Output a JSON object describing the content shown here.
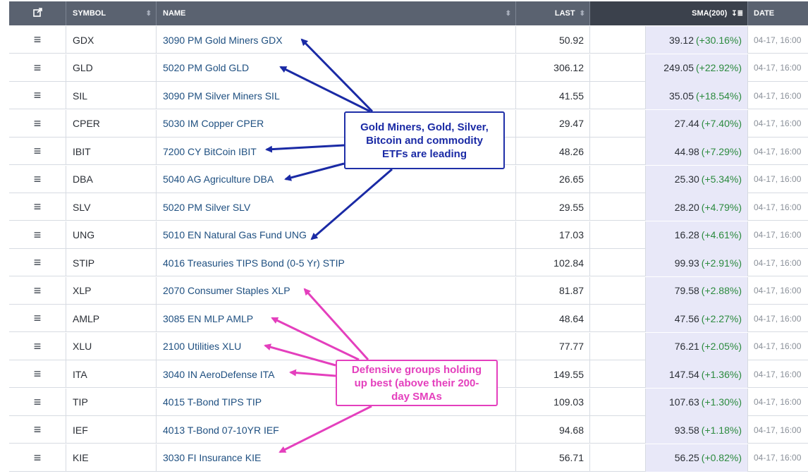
{
  "colors": {
    "header_bg": "#5a6270",
    "name_link": "#1e4f80",
    "sma_bg": "#e8e8f8",
    "positive": "#2b8a3e",
    "blue_annotation": "#1a2aa5",
    "pink_annotation": "#e43fbd"
  },
  "header": {
    "popout_icon": "popout-icon",
    "symbol": "SYMBOL",
    "name": "NAME",
    "last": "LAST",
    "sma": "SMA(200)",
    "date": "DATE"
  },
  "rows": [
    {
      "symbol": "GDX",
      "name": "3090 PM Gold Miners GDX",
      "last": "50.92",
      "sma": "39.12",
      "pct": "(+30.16%)",
      "date": "04-17, 16:00"
    },
    {
      "symbol": "GLD",
      "name": "5020 PM Gold GLD",
      "last": "306.12",
      "sma": "249.05",
      "pct": "(+22.92%)",
      "date": "04-17, 16:00"
    },
    {
      "symbol": "SIL",
      "name": "3090 PM Silver Miners SIL",
      "last": "41.55",
      "sma": "35.05",
      "pct": "(+18.54%)",
      "date": "04-17, 16:00"
    },
    {
      "symbol": "CPER",
      "name": "5030 IM Copper CPER",
      "last": "29.47",
      "sma": "27.44",
      "pct": "(+7.40%)",
      "date": "04-17, 16:00"
    },
    {
      "symbol": "IBIT",
      "name": "7200 CY BitCoin IBIT",
      "last": "48.26",
      "sma": "44.98",
      "pct": "(+7.29%)",
      "date": "04-17, 16:00"
    },
    {
      "symbol": "DBA",
      "name": "5040 AG Agriculture DBA",
      "last": "26.65",
      "sma": "25.30",
      "pct": "(+5.34%)",
      "date": "04-17, 16:00"
    },
    {
      "symbol": "SLV",
      "name": "5020 PM Silver SLV",
      "last": "29.55",
      "sma": "28.20",
      "pct": "(+4.79%)",
      "date": "04-17, 16:00"
    },
    {
      "symbol": "UNG",
      "name": "5010 EN Natural Gas Fund UNG",
      "last": "17.03",
      "sma": "16.28",
      "pct": "(+4.61%)",
      "date": "04-17, 16:00"
    },
    {
      "symbol": "STIP",
      "name": "4016 Treasuries TIPS Bond (0-5 Yr) STIP",
      "last": "102.84",
      "sma": "99.93",
      "pct": "(+2.91%)",
      "date": "04-17, 16:00"
    },
    {
      "symbol": "XLP",
      "name": "2070 Consumer Staples XLP",
      "last": "81.87",
      "sma": "79.58",
      "pct": "(+2.88%)",
      "date": "04-17, 16:00"
    },
    {
      "symbol": "AMLP",
      "name": "3085 EN MLP AMLP",
      "last": "48.64",
      "sma": "47.56",
      "pct": "(+2.27%)",
      "date": "04-17, 16:00"
    },
    {
      "symbol": "XLU",
      "name": "2100 Utilities XLU",
      "last": "77.77",
      "sma": "76.21",
      "pct": "(+2.05%)",
      "date": "04-17, 16:00"
    },
    {
      "symbol": "ITA",
      "name": "3040 IN AeroDefense ITA",
      "last": "149.55",
      "sma": "147.54",
      "pct": "(+1.36%)",
      "date": "04-17, 16:00"
    },
    {
      "symbol": "TIP",
      "name": "4015 T-Bond TIPS TIP",
      "last": "109.03",
      "sma": "107.63",
      "pct": "(+1.30%)",
      "date": "04-17, 16:00"
    },
    {
      "symbol": "IEF",
      "name": "4013 T-Bond 07-10YR IEF",
      "last": "94.68",
      "sma": "93.58",
      "pct": "(+1.18%)",
      "date": "04-17, 16:00"
    },
    {
      "symbol": "KIE",
      "name": "3030 FI Insurance KIE",
      "last": "56.71",
      "sma": "56.25",
      "pct": "(+0.82%)",
      "date": "04-17, 16:00"
    }
  ],
  "annotations": {
    "leaders": "Gold Miners, Gold, Silver, Bitcoin and commodity ETFs are leading",
    "defensive": "Defensive groups holding up best (above their 200-day SMAs"
  }
}
